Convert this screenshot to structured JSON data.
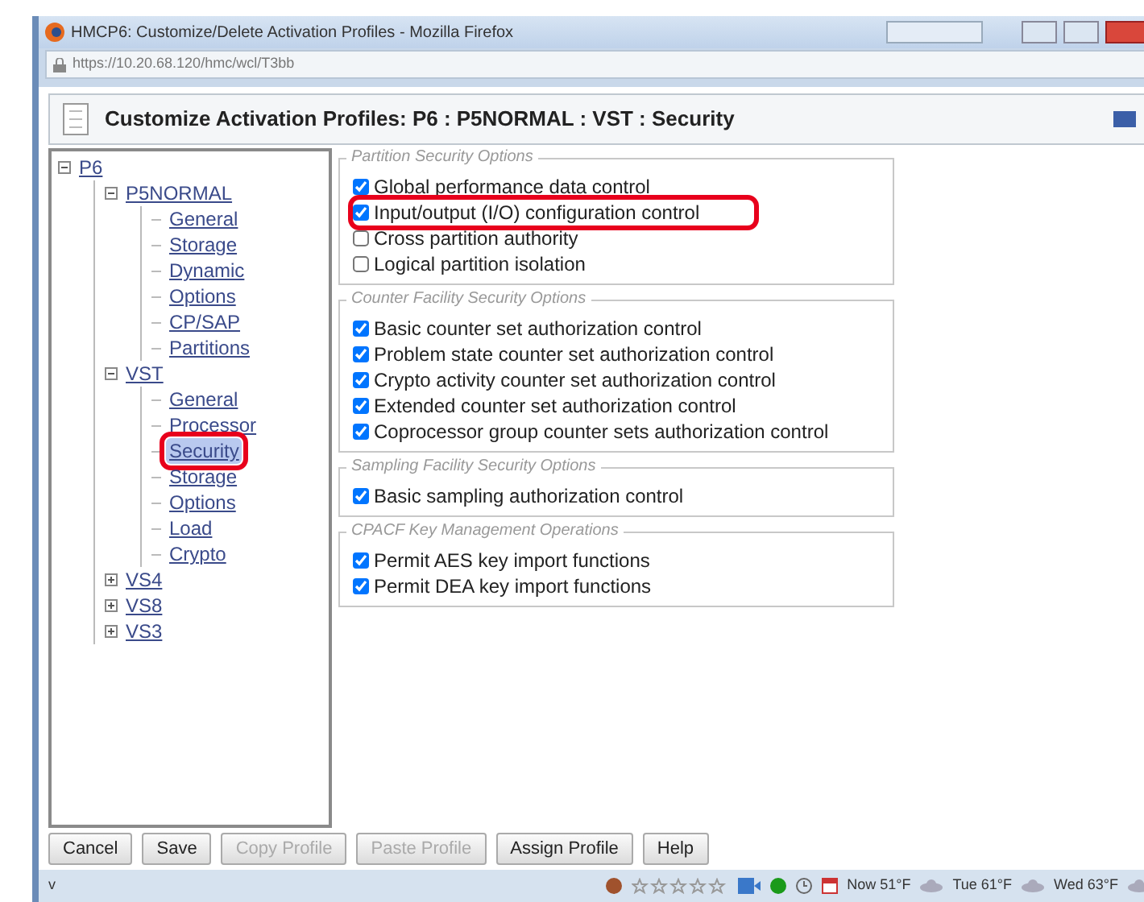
{
  "window": {
    "title": "HMCP6: Customize/Delete Activation Profiles - Mozilla Firefox"
  },
  "address_bar": {
    "url": "https://10.20.68.120/hmc/wcl/T3bb"
  },
  "page": {
    "title": "Customize Activation Profiles: P6 : P5NORMAL : VST : Security"
  },
  "tree": [
    {
      "label": "P6",
      "expanded": true,
      "selected": false,
      "highlighted": false,
      "children": [
        {
          "label": "P5NORMAL",
          "expanded": true,
          "selected": false,
          "highlighted": false,
          "children": [
            {
              "label": "General",
              "selected": false,
              "highlighted": false
            },
            {
              "label": "Storage",
              "selected": false,
              "highlighted": false
            },
            {
              "label": "Dynamic",
              "selected": false,
              "highlighted": false
            },
            {
              "label": "Options",
              "selected": false,
              "highlighted": false
            },
            {
              "label": "CP/SAP",
              "selected": false,
              "highlighted": false
            },
            {
              "label": "Partitions",
              "selected": false,
              "highlighted": false
            }
          ]
        },
        {
          "label": "VST",
          "expanded": true,
          "selected": false,
          "highlighted": false,
          "children": [
            {
              "label": "General",
              "selected": false,
              "highlighted": false
            },
            {
              "label": "Processor",
              "selected": false,
              "highlighted": false
            },
            {
              "label": "Security",
              "selected": true,
              "highlighted": true
            },
            {
              "label": "Storage",
              "selected": false,
              "highlighted": false
            },
            {
              "label": "Options",
              "selected": false,
              "highlighted": false
            },
            {
              "label": "Load",
              "selected": false,
              "highlighted": false
            },
            {
              "label": "Crypto",
              "selected": false,
              "highlighted": false
            }
          ]
        },
        {
          "label": "VS4",
          "expanded": false,
          "selected": false,
          "highlighted": false
        },
        {
          "label": "VS8",
          "expanded": false,
          "selected": false,
          "highlighted": false
        },
        {
          "label": "VS3",
          "expanded": false,
          "selected": false,
          "highlighted": false
        }
      ]
    }
  ],
  "groups": [
    {
      "legend": "Partition Security Options",
      "options": [
        {
          "label": "Global performance data control",
          "checked": true,
          "highlighted": false
        },
        {
          "label": "Input/output (I/O) configuration control",
          "checked": true,
          "highlighted": true
        },
        {
          "label": "Cross partition authority",
          "checked": false,
          "highlighted": false
        },
        {
          "label": "Logical partition isolation",
          "checked": false,
          "highlighted": false
        }
      ]
    },
    {
      "legend": "Counter Facility Security Options",
      "options": [
        {
          "label": "Basic counter set authorization control",
          "checked": true,
          "highlighted": false
        },
        {
          "label": "Problem state counter set authorization control",
          "checked": true,
          "highlighted": false
        },
        {
          "label": "Crypto activity counter set authorization control",
          "checked": true,
          "highlighted": false
        },
        {
          "label": "Extended counter set authorization control",
          "checked": true,
          "highlighted": false
        },
        {
          "label": "Coprocessor group counter sets authorization control",
          "checked": true,
          "highlighted": false
        }
      ]
    },
    {
      "legend": "Sampling Facility Security Options",
      "options": [
        {
          "label": "Basic sampling authorization control",
          "checked": true,
          "highlighted": false
        }
      ]
    },
    {
      "legend": "CPACF Key Management Operations",
      "options": [
        {
          "label": "Permit AES key import functions",
          "checked": true,
          "highlighted": false
        },
        {
          "label": "Permit DEA key import functions",
          "checked": true,
          "highlighted": false
        }
      ]
    }
  ],
  "buttons": [
    {
      "label": "Cancel",
      "disabled": false
    },
    {
      "label": "Save",
      "disabled": false
    },
    {
      "label": "Copy Profile",
      "disabled": true
    },
    {
      "label": "Paste Profile",
      "disabled": true
    },
    {
      "label": "Assign Profile",
      "disabled": false
    },
    {
      "label": "Help",
      "disabled": false
    }
  ],
  "status_bar": {
    "menu": "v",
    "weather": [
      "Now 51°F",
      "Tue 61°F",
      "Wed 63°F"
    ]
  }
}
